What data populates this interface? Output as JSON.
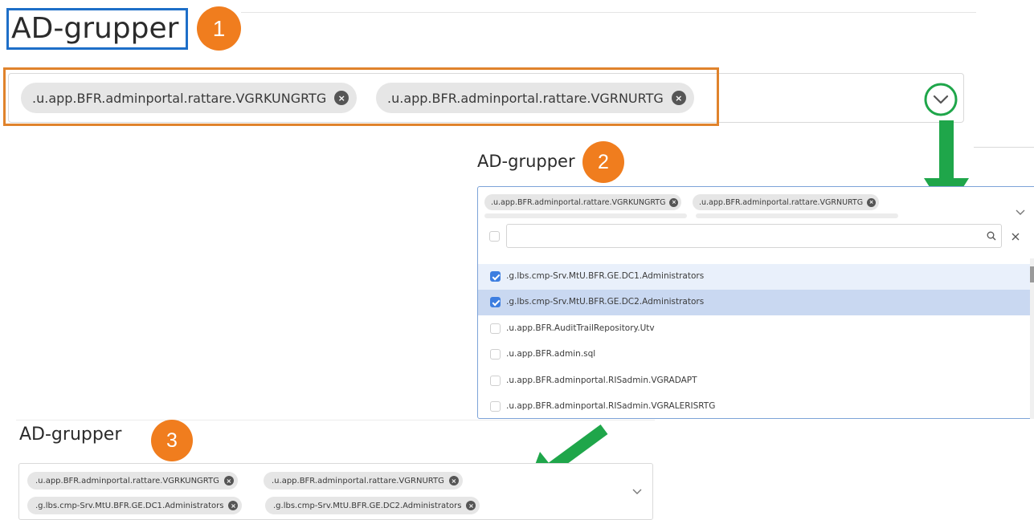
{
  "panel1": {
    "title": "AD-grupper",
    "step": "1",
    "chips": [
      ".u.app.BFR.adminportal.rattare.VGRKUNGRTG",
      ".u.app.BFR.adminportal.rattare.VGRNURTG"
    ]
  },
  "panel2": {
    "title": "AD-grupper",
    "step": "2",
    "chips": [
      ".u.app.BFR.adminportal.rattare.VGRKUNGRTG",
      ".u.app.BFR.adminportal.rattare.VGRNURTG"
    ],
    "search": {
      "value": "",
      "placeholder": ""
    },
    "options": [
      {
        "label": ".g.lbs.cmp-Srv.MtU.BFR.GE.DC1.Administrators",
        "checked": true
      },
      {
        "label": ".g.lbs.cmp-Srv.MtU.BFR.GE.DC2.Administrators",
        "checked": true
      },
      {
        "label": ".u.app.BFR.AuditTrailRepository.Utv",
        "checked": false
      },
      {
        "label": ".u.app.BFR.admin.sql",
        "checked": false
      },
      {
        "label": ".u.app.BFR.adminportal.RISadmin.VGRADAPT",
        "checked": false
      },
      {
        "label": ".u.app.BFR.adminportal.RISadmin.VGRALERISRTG",
        "checked": false
      }
    ]
  },
  "panel3": {
    "title": "AD-grupper",
    "step": "3",
    "chips": [
      ".u.app.BFR.adminportal.rattare.VGRKUNGRTG",
      ".u.app.BFR.adminportal.rattare.VGRNURTG",
      ".g.lbs.cmp-Srv.MtU.BFR.GE.DC1.Administrators",
      ".g.lbs.cmp-Srv.MtU.BFR.GE.DC2.Administrators"
    ]
  },
  "colors": {
    "step_badge": "#f07d1e",
    "title_highlight": "#1e6fc8",
    "field_highlight": "#e0832c",
    "arrow": "#1fa64a",
    "checked": "#3d7ee0"
  },
  "icons": {
    "chip_remove": "×",
    "dropdown": "chevron-down-icon",
    "search": "search-icon",
    "clear": "close-icon",
    "arrow": "arrow-down-icon"
  }
}
